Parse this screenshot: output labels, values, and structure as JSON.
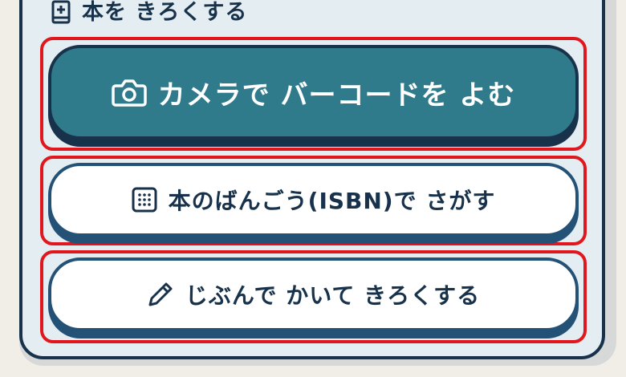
{
  "section": {
    "title": "本を きろくする",
    "icon": "book-plus-icon"
  },
  "actions": {
    "camera_label": "カメラで バーコードを よむ",
    "camera_icon": "camera-icon",
    "isbn_label": "本のばんごう(ISBN)で さがす",
    "isbn_icon": "keypad-icon",
    "manual_label": "じぶんで かいて きろくする",
    "manual_icon": "pencil-icon"
  },
  "colors": {
    "primary": "#2f7b8b",
    "ink": "#17324a",
    "highlight": "#e0181d",
    "panel": "#e4eef2"
  }
}
